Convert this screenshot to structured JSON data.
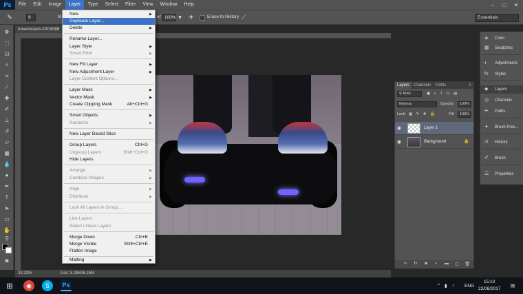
{
  "app": {
    "logo": "Ps"
  },
  "menubar": {
    "items": [
      "File",
      "Edit",
      "Image",
      "Layer",
      "Type",
      "Select",
      "Filter",
      "View",
      "Window",
      "Help"
    ],
    "active": "Layer"
  },
  "window_controls": {
    "minimize": "–",
    "maximize": "□",
    "close": "✕"
  },
  "options_bar": {
    "brush_size": "9",
    "mode_prefix": "M",
    "mode_suffix": "er",
    "flow": "100%",
    "erase_to_history": "Erase to History",
    "workspace": "Essentials"
  },
  "document": {
    "tab_title": "hoverboard-2003088",
    "zoom": "33.33%",
    "doc_size": "Doc: 5.26M/6.26M"
  },
  "layer_menu": {
    "new": "New",
    "duplicate_layer": "Duplicate Layer...",
    "delete": "Delete",
    "rename_layer": "Rename Layer...",
    "layer_style": "Layer Style",
    "smart_filter": "Smart Filter",
    "new_fill_layer": "New Fill Layer",
    "new_adjustment_layer": "New Adjustment Layer",
    "layer_content_options": "Layer Content Options...",
    "layer_mask": "Layer Mask",
    "vector_mask": "Vector Mask",
    "create_clipping_mask": "Create Clipping Mask",
    "create_clipping_mask_shortcut": "Alt+Ctrl+G",
    "smart_objects": "Smart Objects",
    "rasterize": "Rasterize",
    "new_layer_based_slice": "New Layer Based Slice",
    "group_layers": "Group Layers",
    "group_layers_shortcut": "Ctrl+G",
    "ungroup_layers": "Ungroup Layers",
    "ungroup_layers_shortcut": "Shift+Ctrl+G",
    "hide_layers": "Hide Layers",
    "arrange": "Arrange",
    "combine_shapes": "Combine Shapes",
    "align": "Align",
    "distribute": "Distribute",
    "lock_all_layers": "Lock All Layers in Group...",
    "link_layers": "Link Layers",
    "select_linked_layers": "Select Linked Layers",
    "merge_down": "Merge Down",
    "merge_down_shortcut": "Ctrl+E",
    "merge_visible": "Merge Visible",
    "merge_visible_shortcut": "Shift+Ctrl+E",
    "flatten_image": "Flatten Image",
    "matting": "Matting"
  },
  "layers_panel": {
    "tabs": [
      "Layers",
      "Channels",
      "Paths"
    ],
    "filter": "Kind",
    "blend_mode": "Normal",
    "opacity_label": "Opacity:",
    "opacity": "100%",
    "lock_label": "Lock:",
    "fill_label": "Fill:",
    "fill": "100%",
    "layers": [
      {
        "name": "Layer 1",
        "selected": true
      },
      {
        "name": "Background",
        "selected": false,
        "locked": true
      }
    ]
  },
  "dock": {
    "items": [
      "Color",
      "Swatches",
      "Adjustments",
      "Styles",
      "Layers",
      "Channels",
      "Paths",
      "Brush Pres...",
      "History",
      "Brush",
      "Properties"
    ]
  },
  "taskbar": {
    "language": "ENG",
    "time": "15:10",
    "date": "22/08/2017"
  },
  "colors": {
    "accent": "#3d73c4",
    "ps_blue": "#31a8ff",
    "panel": "#535353"
  }
}
